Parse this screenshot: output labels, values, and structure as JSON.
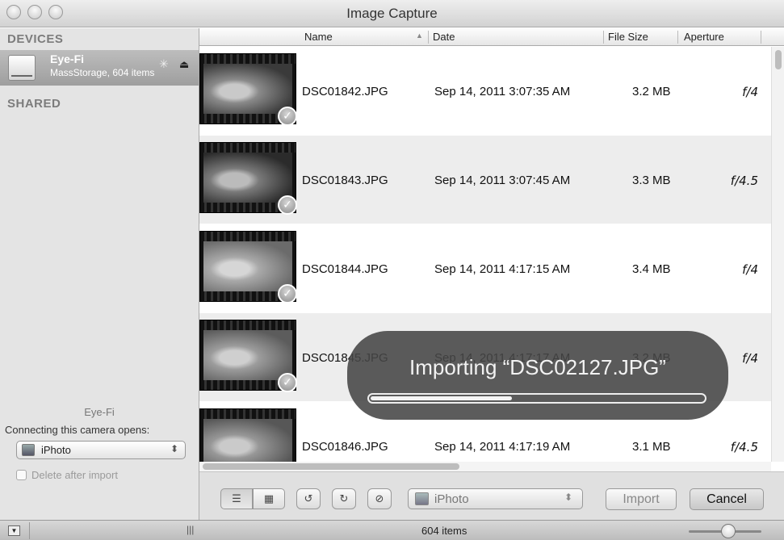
{
  "window": {
    "title": "Image Capture"
  },
  "sidebar": {
    "devices_heading": "DEVICES",
    "shared_heading": "SHARED",
    "device": {
      "name": "Eye-Fi",
      "subtitle": "MassStorage, 604 items",
      "icon": "memory-card-icon"
    },
    "bottom": {
      "device_name": "Eye-Fi",
      "connecting_label": "Connecting this camera opens:",
      "opens_app": "iPhoto",
      "delete_after_import": "Delete after import",
      "delete_checked": false
    }
  },
  "table": {
    "columns": {
      "name": "Name",
      "date": "Date",
      "size": "File Size",
      "aperture": "Aperture"
    },
    "sort": {
      "column": "Name",
      "direction": "ascending"
    },
    "rows": [
      {
        "name": "DSC01842.JPG",
        "date": "Sep 14, 2011 3:07:35 AM",
        "size": "3.2 MB",
        "aperture": "f/4",
        "imported": true
      },
      {
        "name": "DSC01843.JPG",
        "date": "Sep 14, 2011 3:07:45 AM",
        "size": "3.3 MB",
        "aperture": "f/4.5",
        "imported": true
      },
      {
        "name": "DSC01844.JPG",
        "date": "Sep 14, 2011 4:17:15 AM",
        "size": "3.4 MB",
        "aperture": "f/4",
        "imported": true
      },
      {
        "name": "DSC01845.JPG",
        "date": "Sep 14, 2011 4:17:17 AM",
        "size": "3.2 MB",
        "aperture": "f/4",
        "imported": true
      },
      {
        "name": "DSC01846.JPG",
        "date": "Sep 14, 2011 4:17:19 AM",
        "size": "3.1 MB",
        "aperture": "f/4.5",
        "imported": false
      }
    ]
  },
  "overlay": {
    "message": "Importing “DSC02127.JPG”",
    "progress": 0.42
  },
  "toolbar": {
    "import_to": "iPhoto",
    "import_label": "Import",
    "cancel_label": "Cancel"
  },
  "status": {
    "count": "604 items",
    "thumbnail_zoom": 0.55
  },
  "colors": {
    "sidebar_bg": "#e4e4e4",
    "selected_row": "#a8a8a8",
    "hud_bg": "#464646"
  }
}
